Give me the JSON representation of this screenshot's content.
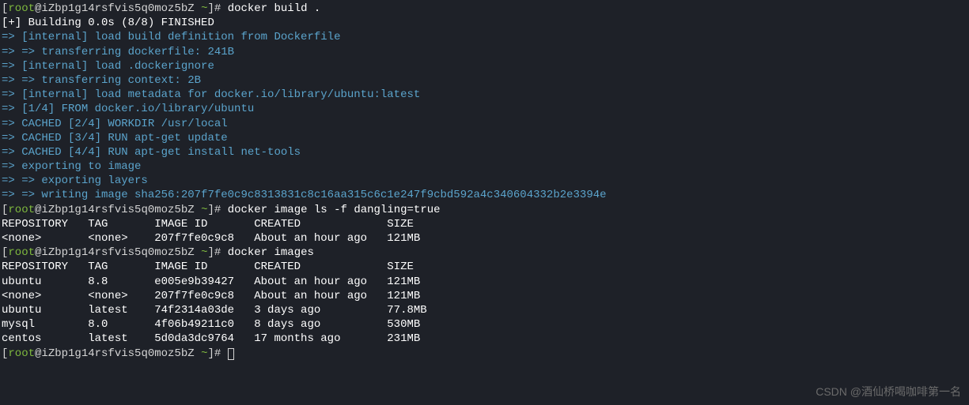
{
  "prompt": {
    "user": "root",
    "host": "iZbp1g14rsfvis5q0moz5bZ",
    "path": "~"
  },
  "commands": {
    "cmd1": "docker build .",
    "cmd2": "docker image ls -f dangling=true",
    "cmd3": "docker images"
  },
  "build": {
    "header": "[+] Building 0.0s (8/8) FINISHED",
    "steps": [
      "=> [internal] load build definition from Dockerfile",
      "=> => transferring dockerfile: 241B",
      "=> [internal] load .dockerignore",
      "=> => transferring context: 2B",
      "=> [internal] load metadata for docker.io/library/ubuntu:latest",
      "=> [1/4] FROM docker.io/library/ubuntu",
      "=> CACHED [2/4] WORKDIR /usr/local",
      "=> CACHED [3/4] RUN apt-get update",
      "=> CACHED [4/4] RUN apt-get install net-tools",
      "=> exporting to image",
      "=> => exporting layers",
      "=> => writing image sha256:207f7fe0c9c8313831c8c16aa315c6c1e247f9cbd592a4c340604332b2e3394e"
    ]
  },
  "table1": {
    "header": "REPOSITORY   TAG       IMAGE ID       CREATED             SIZE",
    "rows": [
      "<none>       <none>    207f7fe0c9c8   About an hour ago   121MB"
    ]
  },
  "table2": {
    "header": "REPOSITORY   TAG       IMAGE ID       CREATED             SIZE",
    "rows": [
      "ubuntu       8.8       e005e9b39427   About an hour ago   121MB",
      "<none>       <none>    207f7fe0c9c8   About an hour ago   121MB",
      "ubuntu       latest    74f2314a03de   3 days ago          77.8MB",
      "mysql        8.0       4f06b49211c0   8 days ago          530MB",
      "centos       latest    5d0da3dc9764   17 months ago       231MB"
    ]
  },
  "watermark": "CSDN @酒仙桥喝咖啡第一名"
}
